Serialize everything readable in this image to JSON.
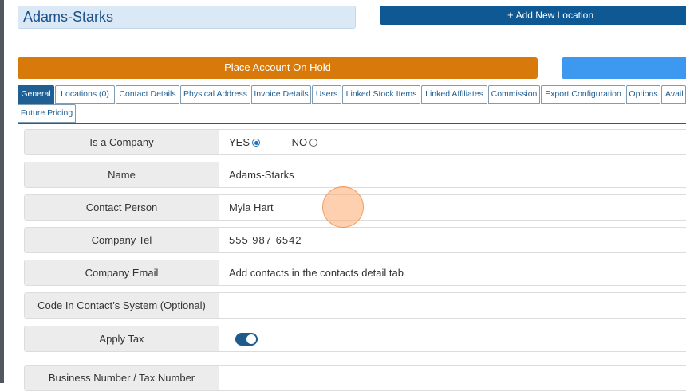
{
  "header": {
    "account_name": "Adams-Starks",
    "add_location_label": "Add New Location",
    "add_location_icon": "plus-icon",
    "hold_label": "Place Account On Hold"
  },
  "colors": {
    "primary": "#0e5893",
    "hold": "#d77a0b",
    "tab_active": "#1f5f93",
    "secondary_button": "#3d99ef"
  },
  "tabs": [
    {
      "label": "General",
      "active": true
    },
    {
      "label": "Locations (0)"
    },
    {
      "label": "Contact Details"
    },
    {
      "label": "Physical Address"
    },
    {
      "label": "Invoice Details"
    },
    {
      "label": "Users"
    },
    {
      "label": "Linked Stock Items"
    },
    {
      "label": "Linked Affiliates"
    },
    {
      "label": "Commission"
    },
    {
      "label": "Export Configuration"
    },
    {
      "label": "Options"
    },
    {
      "label": "Avail"
    },
    {
      "label": "Future Pricing"
    }
  ],
  "form": {
    "is_company": {
      "label": "Is a Company",
      "yes": "YES",
      "no": "NO",
      "selected": "YES"
    },
    "name": {
      "label": "Name",
      "value": "Adams-Starks"
    },
    "contact_person": {
      "label": "Contact Person",
      "value": "Myla Hart"
    },
    "company_tel": {
      "label": "Company Tel",
      "value": "555 987 6542"
    },
    "company_email": {
      "label": "Company Email",
      "value": "Add contacts in the contacts detail tab"
    },
    "code": {
      "label": "Code In Contact’s System (Optional)",
      "value": ""
    },
    "apply_tax": {
      "label": "Apply Tax",
      "enabled": true
    },
    "business_number": {
      "label": "Business Number / Tax Number",
      "value": ""
    }
  }
}
